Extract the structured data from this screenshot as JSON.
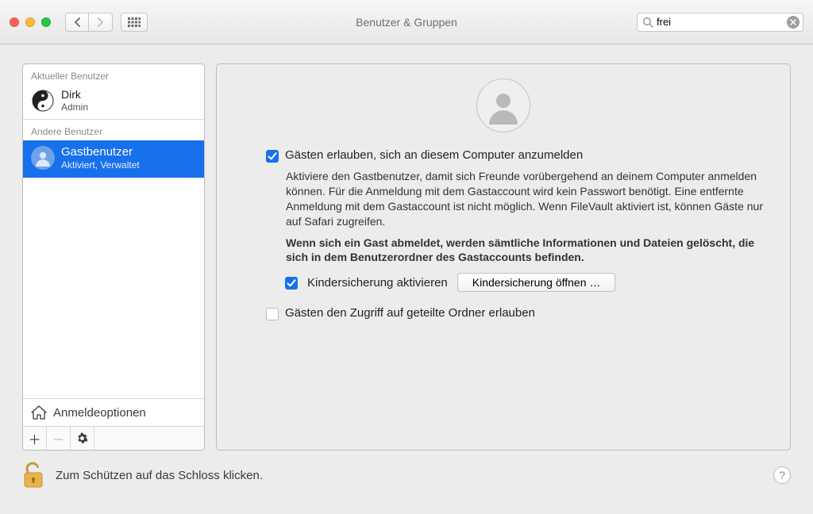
{
  "window": {
    "title": "Benutzer & Gruppen"
  },
  "search": {
    "value": "frei"
  },
  "sidebar": {
    "currentHeader": "Aktueller Benutzer",
    "otherHeader": "Andere Benutzer",
    "current": {
      "name": "Dirk",
      "role": "Admin"
    },
    "guest": {
      "name": "Gastbenutzer",
      "sub": "Aktiviert, Verwaltet"
    },
    "loginOptions": "Anmeldeoptionen"
  },
  "main": {
    "allowGuests": {
      "checked": true,
      "label": "Gästen erlauben, sich an diesem Computer anzumelden",
      "desc": "Aktiviere den Gastbenutzer, damit sich Freunde vorübergehend an deinem Computer anmelden können. Für die Anmeldung mit dem Gastaccount wird kein Passwort benötigt. Eine entfernte Anmeldung mit dem Gastaccount ist nicht möglich. Wenn FileVault aktiviert ist, können Gäste nur auf Safari zugreifen.",
      "descBold": "Wenn sich ein Gast abmeldet, werden sämtliche Informationen und Dateien gelöscht, die sich in dem Benutzerordner des Gastaccounts befinden."
    },
    "parental": {
      "checked": true,
      "label": "Kindersicherung aktivieren",
      "button": "Kindersicherung öffnen …"
    },
    "sharedFolders": {
      "checked": false,
      "label": "Gästen den Zugriff auf geteilte Ordner erlauben"
    }
  },
  "footer": {
    "lockText": "Zum Schützen auf das Schloss klicken."
  }
}
